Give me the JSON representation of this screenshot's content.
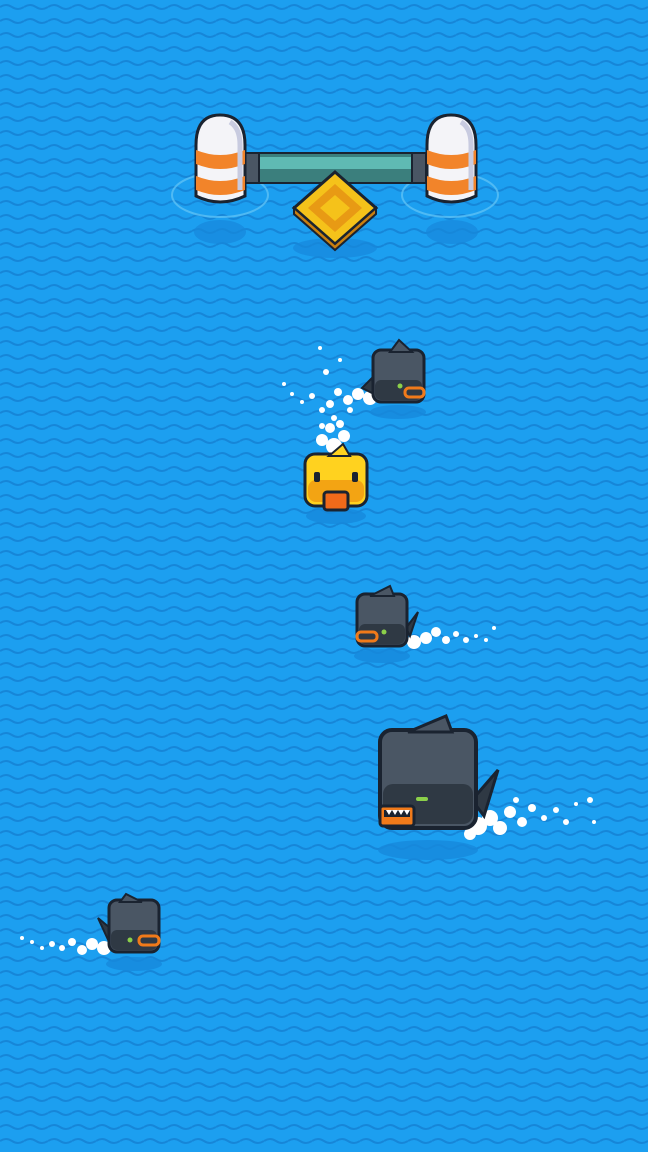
{
  "game": {
    "scene": "ocean",
    "colors": {
      "water": "#1c9ff0",
      "wave_line": "#1686d8",
      "shark_body": "#4a5664",
      "shark_belly": "#2f3944",
      "shark_outline": "#1a2330",
      "shark_mouth": "#f07a1a",
      "shark_eye": "#8bd04a",
      "duck_body": "#ffd21f",
      "duck_beak": "#f06a1a",
      "buoy_white": "#f4f4f8",
      "buoy_stripe": "#f2842a",
      "bar": "#4aa8a2",
      "gem": "#f5c21a",
      "splash": "#ffffff"
    },
    "entities": [
      {
        "kind": "goal-gate",
        "name": "finish-gate",
        "items": [
          "left-buoy",
          "right-buoy",
          "bar",
          "diamond-gem"
        ]
      },
      {
        "kind": "player",
        "name": "yellow-duck",
        "heading": "up"
      },
      {
        "kind": "enemy",
        "name": "small-shark-1",
        "size": "small",
        "facing": "right"
      },
      {
        "kind": "enemy",
        "name": "small-shark-2",
        "size": "small",
        "facing": "left"
      },
      {
        "kind": "enemy",
        "name": "big-shark",
        "size": "large",
        "facing": "left"
      },
      {
        "kind": "enemy",
        "name": "small-shark-3",
        "size": "small",
        "facing": "right"
      }
    ]
  }
}
